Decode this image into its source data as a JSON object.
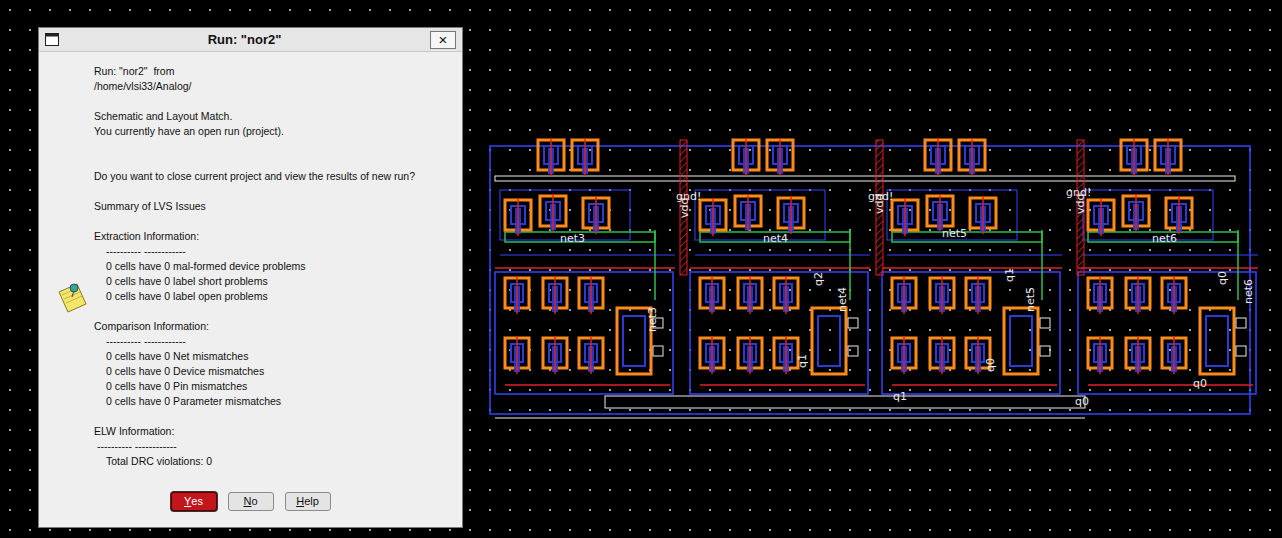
{
  "window": {
    "title": "Run: \"nor2\"",
    "close": "×"
  },
  "message": {
    "header": [
      "Run: \"nor2\"  from",
      "/home/vlsi33/Analog/"
    ],
    "status": [
      "Schematic and Layout Match.",
      "You currently have an open run (project)."
    ],
    "question": "Do you want to close current project and view the results of new run?",
    "summary": "Summary of LVS Issues"
  },
  "sections": [
    {
      "title": "Extraction Information:",
      "rule": "---------- ------------",
      "items": [
        "0 cells have 0 mal-formed device problems",
        "0 cells have 0 label short problems",
        "0 cells have 0 label open problems"
      ]
    },
    {
      "title": "Comparison Information:",
      "rule": "---------- ------------",
      "items": [
        "0 cells have 0 Net mismatches",
        "0 cells have 0 Device mismatches",
        "0 cells have 0 Pin mismatches",
        "0 cells have 0 Parameter mismatches"
      ]
    },
    {
      "title": "ELW Information:",
      "rule": " ---------- ------------",
      "items": [
        "Total DRC violations: 0"
      ]
    }
  ],
  "buttons": [
    {
      "label": "Yes",
      "selected": true
    },
    {
      "label": "No",
      "selected": false
    },
    {
      "label": "Help",
      "selected": false
    }
  ],
  "layout": {
    "labels": [
      {
        "text": "gnd!",
        "vertical": false
      },
      {
        "text": "gnd!",
        "vertical": false
      },
      {
        "text": "gnd!",
        "vertical": false
      },
      {
        "text": "vdd",
        "vertical": true
      },
      {
        "text": "vdd",
        "vertical": true
      },
      {
        "text": "vdd",
        "vertical": true
      },
      {
        "text": "net3",
        "vertical": false
      },
      {
        "text": "net4",
        "vertical": false
      },
      {
        "text": "net5",
        "vertical": false
      },
      {
        "text": "net6",
        "vertical": false
      },
      {
        "text": "net3",
        "vertical": true
      },
      {
        "text": "net4",
        "vertical": true
      },
      {
        "text": "net5",
        "vertical": true
      },
      {
        "text": "net6",
        "vertical": true
      },
      {
        "text": "q2",
        "vertical": true
      },
      {
        "text": "q1",
        "vertical": true
      },
      {
        "text": "q0",
        "vertical": true
      },
      {
        "text": "q1",
        "vertical": true
      },
      {
        "text": "q0",
        "vertical": true
      },
      {
        "text": "q1",
        "vertical": false
      },
      {
        "text": "q0",
        "vertical": false
      },
      {
        "text": "q0",
        "vertical": false
      }
    ]
  }
}
